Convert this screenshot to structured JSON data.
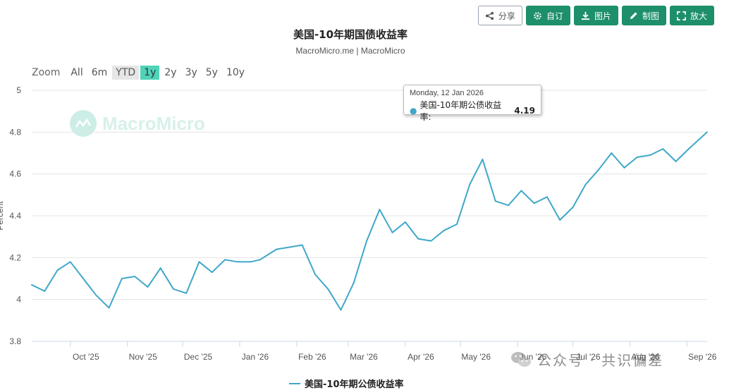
{
  "toolbar": {
    "share_label": "分享",
    "custom_label": "自订",
    "image_label": "图片",
    "draw_label": "制图",
    "enlarge_label": "放大"
  },
  "zoom": {
    "label": "Zoom",
    "options": [
      "All",
      "6m",
      "YTD",
      "1y",
      "2y",
      "3y",
      "5y",
      "10y"
    ],
    "active": "1y"
  },
  "watermark": "MacroMicro",
  "wechat_watermark": "公众号 · 共识偏差",
  "tooltip": {
    "date": "Monday, 12 Jan 2026",
    "series": "美国-10年期公债收益率: ",
    "value": "4.19"
  },
  "colors": {
    "series": "#3fa7c9",
    "accent": "#1d8f6a",
    "active_zoom": "#4fd3b9"
  },
  "chart_data": {
    "type": "line",
    "title": "美国-10年期国债收益率",
    "subtitle": "MacroMicro.me | MacroMicro",
    "ylabel": "Percent",
    "xlabel": "",
    "ylim": [
      3.8,
      5.0
    ],
    "yticks": [
      3.8,
      4,
      4.2,
      4.4,
      4.6,
      4.8,
      5
    ],
    "xticks": [
      "Oct '25",
      "Nov '25",
      "Dec '25",
      "Jan '26",
      "Feb '26",
      "Mar '26",
      "Apr '26",
      "May '26",
      "Jun '26",
      "Jul '26",
      "Aug '26",
      "Sep '26"
    ],
    "xrange": [
      "2025-09-10",
      "2026-09-12"
    ],
    "grid": true,
    "legend_position": "bottom",
    "series": [
      {
        "name": "美国-10年期公债收益率",
        "x": [
          "2025-09-10",
          "2025-09-17",
          "2025-09-24",
          "2025-10-01",
          "2025-10-08",
          "2025-10-15",
          "2025-10-22",
          "2025-10-29",
          "2025-11-05",
          "2025-11-12",
          "2025-11-19",
          "2025-11-26",
          "2025-12-03",
          "2025-12-10",
          "2025-12-17",
          "2025-12-24",
          "2025-12-31",
          "2026-01-07",
          "2026-01-12",
          "2026-01-21",
          "2026-01-28",
          "2026-02-04",
          "2026-02-11",
          "2026-02-18",
          "2026-02-25",
          "2026-03-04",
          "2026-03-11",
          "2026-03-18",
          "2026-03-25",
          "2026-04-01",
          "2026-04-08",
          "2026-04-15",
          "2026-04-22",
          "2026-04-29",
          "2026-05-06",
          "2026-05-13",
          "2026-05-20",
          "2026-05-27",
          "2026-06-03",
          "2026-06-10",
          "2026-06-17",
          "2026-06-24",
          "2026-07-01",
          "2026-07-08",
          "2026-07-15",
          "2026-07-22",
          "2026-07-29",
          "2026-08-05",
          "2026-08-12",
          "2026-08-19",
          "2026-08-26",
          "2026-09-02",
          "2026-09-12"
        ],
        "y": [
          4.07,
          4.04,
          4.14,
          4.18,
          4.1,
          4.02,
          3.96,
          4.1,
          4.11,
          4.06,
          4.15,
          4.05,
          4.03,
          4.18,
          4.13,
          4.19,
          4.18,
          4.18,
          4.19,
          4.24,
          4.25,
          4.26,
          4.12,
          4.05,
          3.95,
          4.08,
          4.28,
          4.43,
          4.32,
          4.37,
          4.29,
          4.28,
          4.33,
          4.36,
          4.55,
          4.67,
          4.47,
          4.45,
          4.52,
          4.46,
          4.49,
          4.38,
          4.44,
          4.55,
          4.62,
          4.7,
          4.63,
          4.68,
          4.69,
          4.72,
          4.66,
          4.72,
          4.8
        ]
      }
    ]
  }
}
